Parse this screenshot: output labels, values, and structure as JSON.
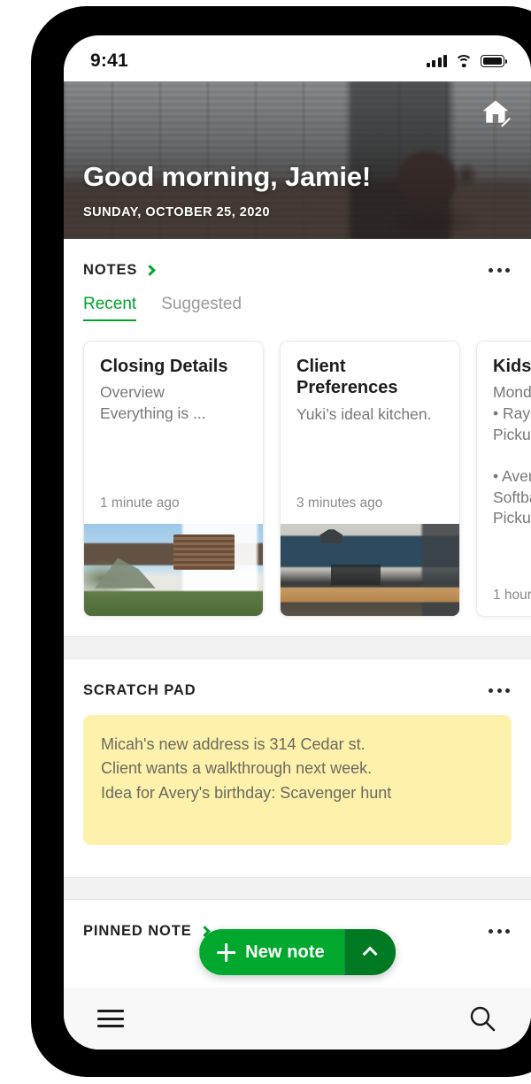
{
  "status_bar": {
    "time": "9:41",
    "signal_icon": "signal-bars-icon",
    "wifi_icon": "wifi-icon",
    "battery_icon": "battery-icon"
  },
  "hero": {
    "greeting": "Good morning, Jamie!",
    "date": "SUNDAY, OCTOBER 25, 2020",
    "action_icon": "home-edit-icon"
  },
  "notes_section": {
    "title": "NOTES",
    "chevron_icon": "chevron-right-icon",
    "overflow_icon": "kebab-menu-icon",
    "tabs": [
      {
        "label": "Recent",
        "active": true
      },
      {
        "label": "Suggested",
        "active": false
      }
    ],
    "cards": [
      {
        "title": "Closing Details",
        "snippet": "Overview\nEverything is ...",
        "time": "1 minute ago",
        "thumb": "modern-house-photo"
      },
      {
        "title": "Client Preferences",
        "snippet": "Yuki’s ideal kitchen.",
        "time": "3 minutes ago",
        "thumb": "blue-kitchen-photo"
      },
      {
        "title": "Kids’",
        "snippet": "Mond\n• Ray -\nPickup\n\n• Aver\nSoftba\nPickup",
        "time": "1 hour",
        "thumb": "none"
      }
    ]
  },
  "scratch_pad": {
    "title": "SCRATCH PAD",
    "overflow_icon": "kebab-menu-icon",
    "lines": [
      "Micah's new address is 314 Cedar st.",
      "Client wants a walkthrough next week.",
      "Idea for Avery's birthday: Scavenger hunt"
    ]
  },
  "pinned_note": {
    "title": "PINNED NOTE",
    "chevron_icon": "chevron-right-icon",
    "overflow_icon": "kebab-menu-icon"
  },
  "fab": {
    "label": "New note",
    "plus_icon": "plus-icon",
    "caret_icon": "chevron-up-icon"
  },
  "bottom_bar": {
    "menu_icon": "hamburger-menu-icon",
    "search_icon": "search-icon"
  },
  "colors": {
    "accent_green": "#00a82d",
    "accent_green_dark": "#007a22",
    "tab_active": "#00a32a",
    "scratch_yellow": "#fdf1ab",
    "band_gray": "#f2f2f2"
  }
}
